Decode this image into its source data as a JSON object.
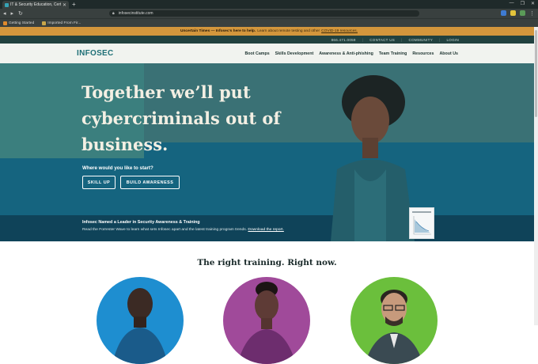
{
  "browser": {
    "tab_title": "IT & Security Education, Certifi...",
    "url": "infosecinstitute.com",
    "bookmarks": [
      "Getting Started",
      "Imported From Fir..."
    ]
  },
  "alert": {
    "bold": "Uncertain Times — Infosec’s here to help.",
    "text": "Learn about remote testing and other",
    "link": "COVID-19 resources."
  },
  "utility_nav": {
    "phone": "866.471.0059",
    "items": [
      "CONTACT US",
      "COMMUNITY",
      "LOGIN"
    ]
  },
  "main_nav": {
    "logo": "INFOSEC",
    "links": [
      "Boot Camps",
      "Skills Development",
      "Awareness & Anti-phishing",
      "Team Training",
      "Resources",
      "About Us"
    ]
  },
  "hero": {
    "headline": "Together we’ll put cybercriminals out of business.",
    "question": "Where would you like to start?",
    "btn_skill": "SKILL UP",
    "btn_awareness": "BUILD AWARENESS",
    "leader_title": "Infosec Named a Leader in Security Awareness & Training",
    "leader_text": "Read the Forrester Wave to learn what sets Infosec apart and the latest training program trends.",
    "leader_link": "Download the report."
  },
  "section": {
    "title": "The right training. Right now."
  },
  "colors": {
    "accent": "#1e6f76",
    "alert": "#d3963c",
    "hero_teal": "#3b7f7e",
    "hero_blue": "#15647f"
  }
}
